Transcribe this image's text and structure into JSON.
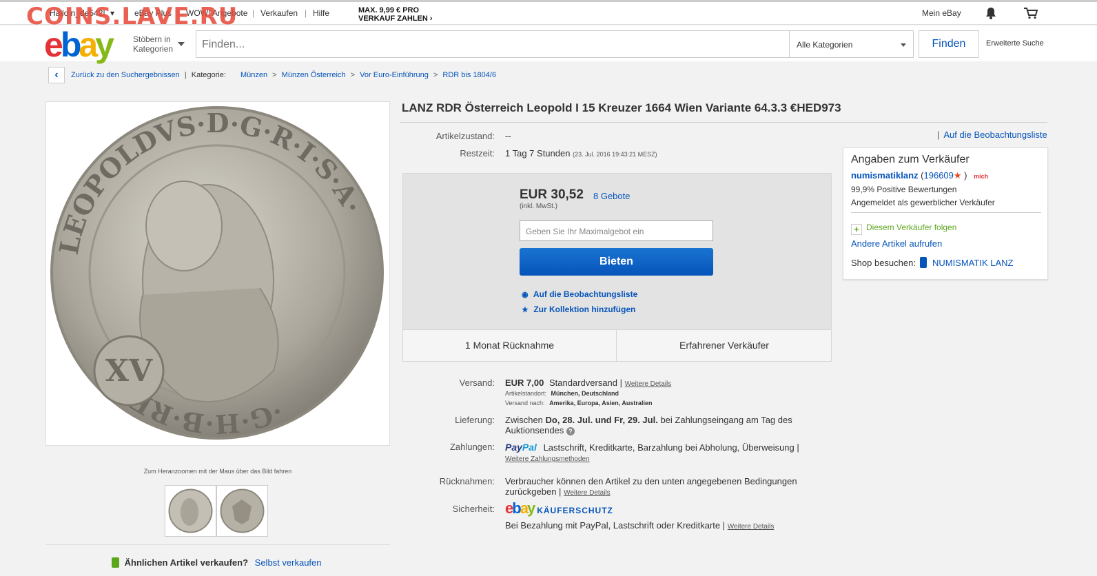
{
  "watermark": "COINS.LAVE.RU",
  "topbar": {
    "greeting": "Hallo n_de542!",
    "ebay_plus": "eBay Plus",
    "wow": "WOW! Angebote",
    "sell": "Verkaufen",
    "help": "Hilfe",
    "promo_line1": "MAX. 9,99 € PRO",
    "promo_line2": "VERKAUF ZAHLEN ›",
    "my_ebay": "Mein eBay"
  },
  "header": {
    "browse_line1": "Stöbern in",
    "browse_line2": "Kategorien",
    "search_placeholder": "Finden...",
    "category": "Alle Kategorien",
    "find": "Finden",
    "advanced": "Erweiterte Suche"
  },
  "breadcrumb": {
    "back": "Zurück zu den Suchergebnissen",
    "category_label": "Kategorie:",
    "items": [
      "Münzen",
      "Münzen Österreich",
      "Vor Euro-Einführung",
      "RDR bis 1804/6"
    ]
  },
  "gallery": {
    "zoom_hint": "Zum Heranzoomen mit der Maus über das Bild fahren",
    "sell_question": "Ähnlichen Artikel verkaufen?",
    "sell_link": "Selbst verkaufen",
    "coin_legend_left": "LEOPOLDVS·D·G·R·I·S·A·",
    "coin_legend_right": "·G·H·B·REX",
    "coin_value": "XV"
  },
  "item": {
    "title": "LANZ RDR Österreich Leopold I 15 Kreuzer 1664 Wien Variante 64.3.3 €HED973",
    "condition_label": "Artikelzustand:",
    "condition": "--",
    "time_label": "Restzeit:",
    "time_left": "1 Tag 7 Stunden",
    "end_date": "(23. Jul. 2016   19:43:21 MESZ)",
    "watch_top": "Auf die Beobachtungsliste"
  },
  "bid": {
    "price": "EUR 30,52",
    "bids": "8 Gebote",
    "vat": "(inkl. MwSt.)",
    "max_placeholder": "Geben Sie Ihr Maximalgebot ein",
    "bid_button": "Bieten",
    "watch": "Auf die Beobachtungsliste",
    "collection": "Zur Kollektion hinzufügen",
    "badge_return": "1 Monat Rücknahme",
    "badge_seller": "Erfahrener Verkäufer"
  },
  "seller": {
    "heading": "Angaben zum Verkäufer",
    "name": "numismatiklanz",
    "score": "196609",
    "me_badge": "mich",
    "positive": "99,9% Positive Bewertungen",
    "business": "Angemeldet als gewerblicher Verkäufer",
    "follow": "Diesem Verkäufer folgen",
    "other_items": "Andere Artikel aufrufen",
    "shop_label": "Shop besuchen:",
    "shop_name": "NUMISMATIK LANZ"
  },
  "shipping": {
    "label": "Versand:",
    "cost": "EUR 7,00",
    "method": "Standardversand |",
    "more": "Weitere Details",
    "location_label": "Artikelstandort:",
    "location": "München, Deutschland",
    "ships_to_label": "Versand nach:",
    "ships_to": "Amerika, Europa, Asien, Australien"
  },
  "delivery": {
    "label": "Lieferung:",
    "prefix": "Zwischen",
    "dates": "Do, 28. Jul. und Fr, 29. Jul.",
    "suffix": "bei Zahlungseingang am Tag des",
    "line2": "Auktionsendes"
  },
  "payment": {
    "label": "Zahlungen:",
    "paypal_1": "Pay",
    "paypal_2": "Pal",
    "methods": "Lastschrift,  Kreditkarte,  Barzahlung bei Abholung,  Überweisung  |",
    "more": "Weitere Zahlungsmethoden"
  },
  "returns": {
    "label": "Rücknahmen:",
    "line1": "Verbraucher können den Artikel zu den unten angegebenen Bedingungen",
    "line2": "zurückgeben |",
    "more": "Weitere Details"
  },
  "security": {
    "label": "Sicherheit:",
    "protection": "KÄUFERSCHUTZ",
    "text": "Bei Bezahlung mit PayPal, Lastschrift oder Kreditkarte |",
    "more": "Weitere Details"
  },
  "colors": {
    "link": "#0654ba",
    "bid_button": "#0654ba",
    "watermark": "#e84c3d"
  }
}
